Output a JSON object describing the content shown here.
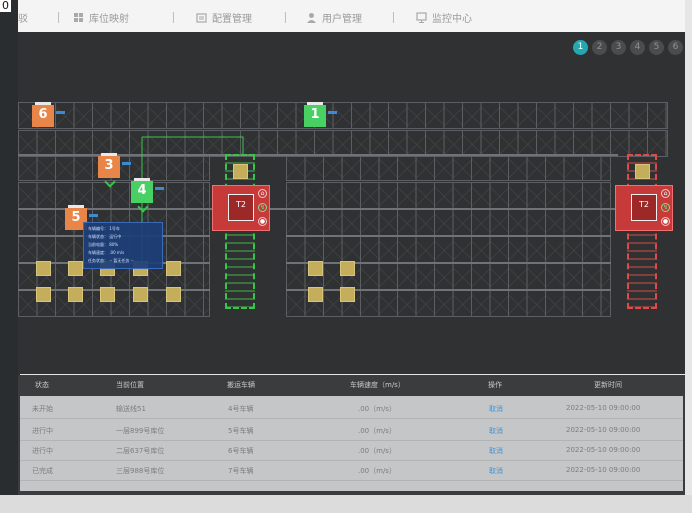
{
  "top_left_fragment": "0",
  "nav": {
    "items": [
      {
        "label": "驳",
        "icon": "none"
      },
      {
        "label": "库位映射",
        "icon": "grid-icon"
      },
      {
        "label": "配置管理",
        "icon": "settings-icon"
      },
      {
        "label": "用户管理",
        "icon": "user-icon"
      },
      {
        "label": "监控中心",
        "icon": "monitor-icon"
      }
    ]
  },
  "pager": {
    "pages": [
      "1",
      "2",
      "3",
      "4",
      "5",
      "6"
    ],
    "active": "1"
  },
  "markers": [
    {
      "label": "6",
      "color": "#e8864a"
    },
    {
      "label": "1",
      "color": "#48d064"
    },
    {
      "label": "3",
      "color": "#e8864a"
    },
    {
      "label": "4",
      "color": "#48d064"
    },
    {
      "label": "5",
      "color": "#e8864a"
    }
  ],
  "vehicles": [
    {
      "label": "T2"
    },
    {
      "label": "T2"
    }
  ],
  "popup": {
    "rows": [
      "车辆编号：  1号车",
      "车辆状态：  运行中",
      "当前电量：  80%",
      "车辆速度：  .00 m/s",
      "任务状态：  -- 暂无任务 --"
    ]
  },
  "table": {
    "headers": [
      "状态",
      "当前位置",
      "搬运车辆",
      "车辆速度（m/s）",
      "操作",
      "更新时间"
    ],
    "rows": [
      [
        "未开始",
        "输送线51",
        "4号车辆",
        ".00（m/s）",
        "取消",
        "2022-05-10  09:00:00"
      ],
      [
        "进行中",
        "一层899号库位",
        "5号车辆",
        ".00（m/s）",
        "取消",
        "2022-05-10  09:00:00"
      ],
      [
        "进行中",
        "二层637号库位",
        "6号车辆",
        ".00（m/s）",
        "取消",
        "2022-05-10  09:00:00"
      ],
      [
        "已完成",
        "三层988号库位",
        "7号车辆",
        ".00（m/s）",
        "取消",
        "2022-05-10  09:00:00"
      ]
    ]
  },
  "colors": {
    "accent": "#21a8b0",
    "rack_line": "#5b5f63",
    "lift_green": "#36c74a",
    "lift_red": "#e04a4a",
    "vehicle_red": "#c73a3a",
    "cargo": "#c4ad5b",
    "link_blue": "#3f93d6"
  }
}
